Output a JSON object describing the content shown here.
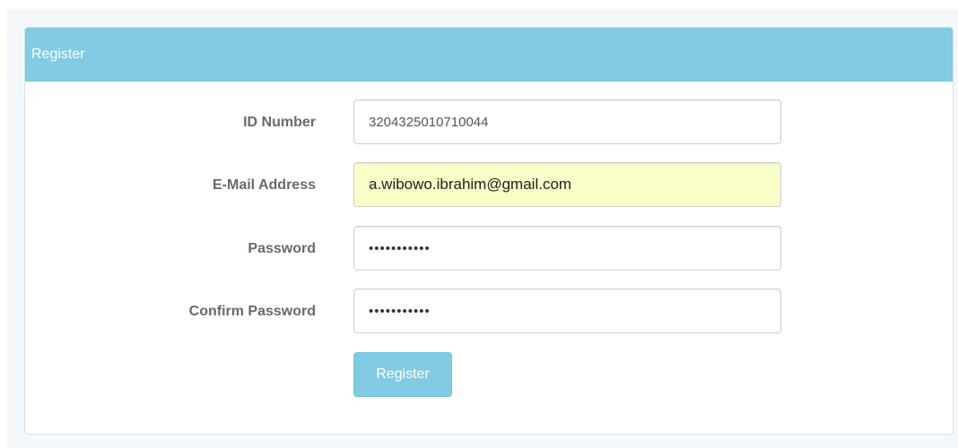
{
  "panel": {
    "title": "Register"
  },
  "form": {
    "id_number": {
      "label": "ID Number",
      "value": "3204325010710044"
    },
    "email": {
      "label": "E-Mail Address",
      "value": "a.wibowo.ibrahim@gmail.com"
    },
    "password": {
      "label": "Password",
      "value": "•••••••••••"
    },
    "confirm_password": {
      "label": "Confirm Password",
      "value": "•••••••••••"
    },
    "submit_label": "Register"
  },
  "colors": {
    "heading_bg": "#82cbe2",
    "autofill_bg": "#fafdc8",
    "label_text": "#636b6f"
  }
}
